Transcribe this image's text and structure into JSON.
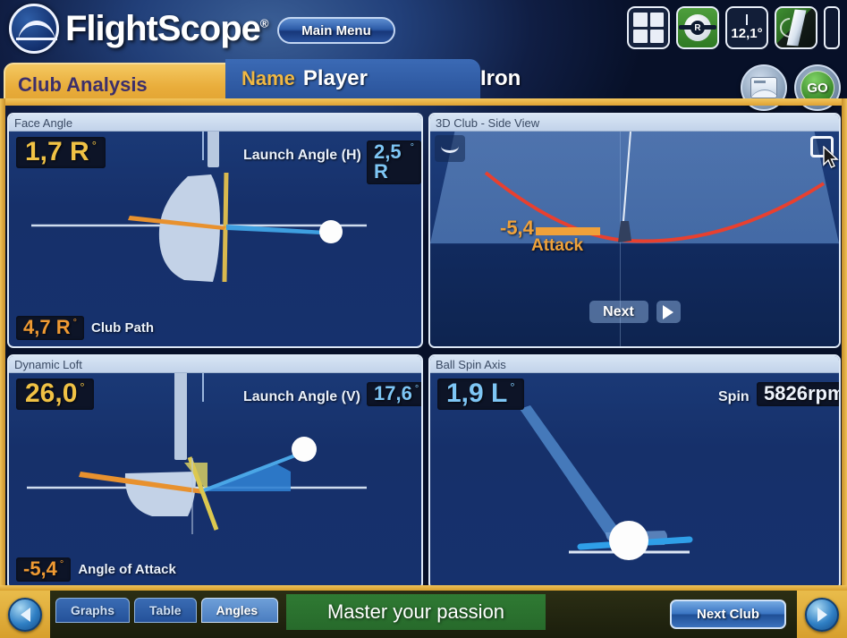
{
  "brand": {
    "name": "FlightScope",
    "registered": "®",
    "logo_icon": "flightscope-logo-icon"
  },
  "header": {
    "main_menu_label": "Main Menu",
    "tools": [
      {
        "name": "grid-view-icon",
        "label": ""
      },
      {
        "name": "ball-radar-icon",
        "label": "R"
      },
      {
        "name": "angle-readout-icon",
        "label": "12,1°"
      },
      {
        "name": "radar-signal-icon",
        "label": ""
      }
    ]
  },
  "tabs": {
    "active_tab": "Club Analysis",
    "name_label": "Name",
    "name_value": "Player",
    "club_value": "Iron",
    "open_button": "open-file-icon",
    "go_button": "GO"
  },
  "panels": {
    "face_angle": {
      "title": "Face Angle",
      "primary_value": "1,7 R",
      "primary_degree": "°",
      "secondary_label": "Launch Angle (H)",
      "secondary_value": "2,5 R",
      "secondary_degree": "°",
      "footer_value": "4,7 R",
      "footer_degree": "°",
      "footer_label": "Club Path"
    },
    "dynamic_loft": {
      "title": "Dynamic Loft",
      "primary_value": "26,0",
      "primary_degree": "°",
      "secondary_label": "Launch Angle (V)",
      "secondary_value": "17,6",
      "secondary_degree": "°",
      "footer_value": "-5,4",
      "footer_degree": "°",
      "footer_label": "Angle of Attack"
    },
    "club_3d": {
      "title": "3D Club - Side View",
      "attack_value": "-5,4",
      "attack_label": "Attack",
      "next_label": "Next",
      "play_icon": "play-icon",
      "maximize_icon": "maximize-icon",
      "corner_icon": "club-face-icon",
      "cursor_icon": "mouse-cursor-icon"
    },
    "ball_spin_axis": {
      "title": "Ball Spin Axis",
      "primary_value": "1,9 L",
      "primary_degree": "°",
      "spin_label": "Spin",
      "spin_value": "5826rpm"
    }
  },
  "footer": {
    "prev_icon": "previous-arrow-icon",
    "next_icon": "next-arrow-icon",
    "view_tabs": [
      {
        "label": "Graphs",
        "active": false
      },
      {
        "label": "Table",
        "active": false
      },
      {
        "label": "Angles",
        "active": true
      }
    ],
    "tagline": "Master your passion",
    "next_club_label": "Next Club"
  },
  "colors": {
    "gold": "#e9ad3b",
    "accent_blue": "#7ec6f5",
    "orange": "#ef9a33",
    "green": "#2f7a33",
    "panel_blue": "#16306a",
    "swing_arc_red": "#e8402f"
  }
}
